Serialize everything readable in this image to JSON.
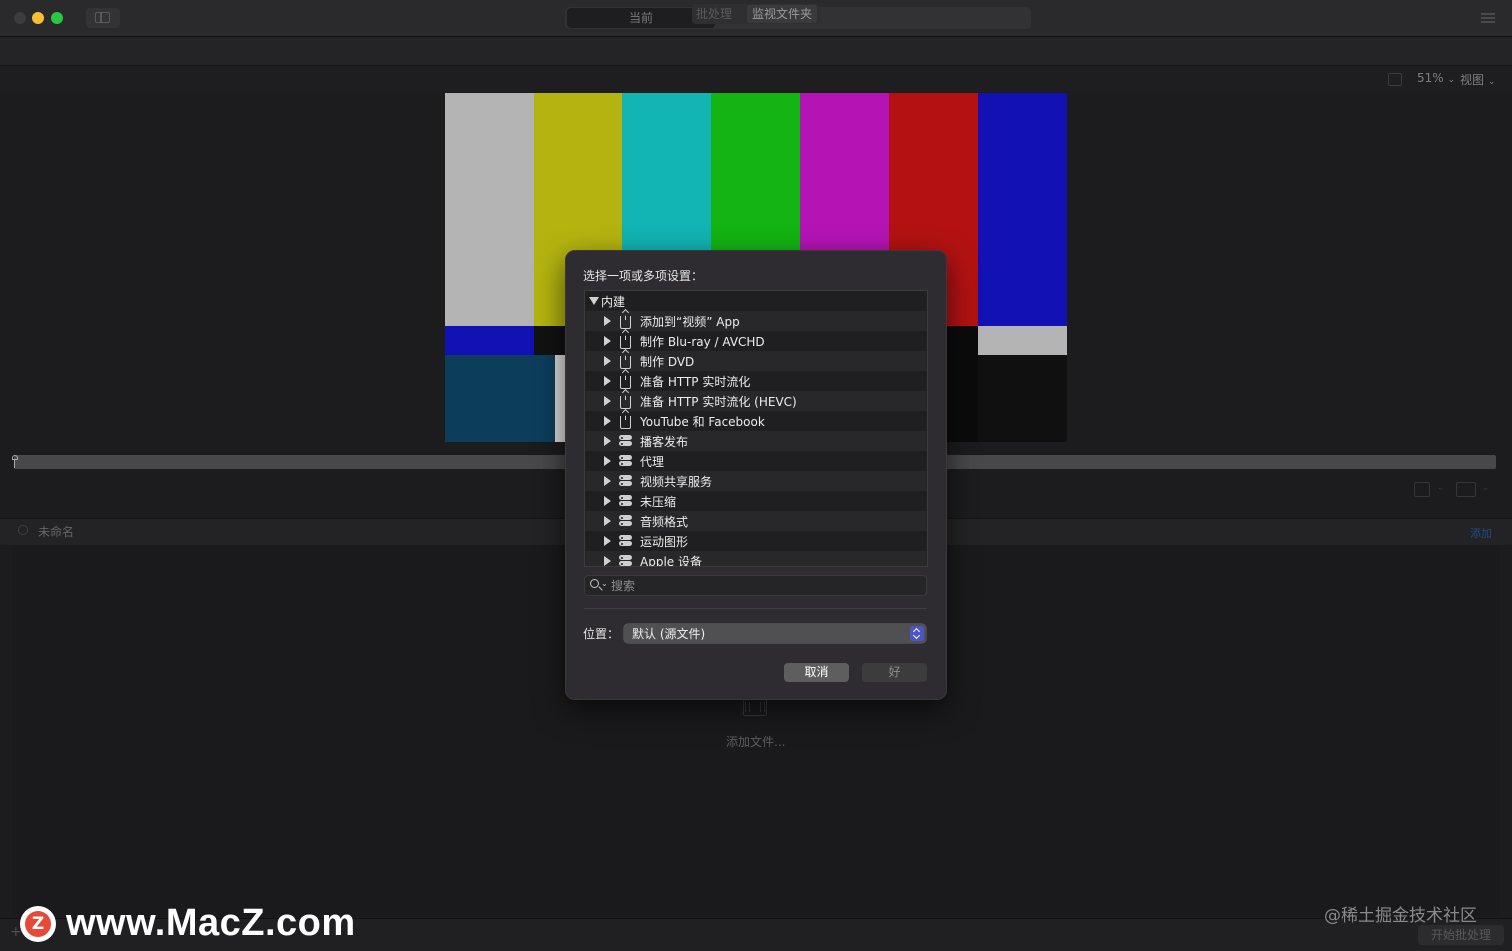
{
  "toolbar": {
    "segments": [
      "当前",
      "",
      ""
    ],
    "sub_segments": [
      "批处理",
      "监视文件夹"
    ]
  },
  "viewer": {
    "zoom": "51%",
    "zoom_chevron": "⌄",
    "view_label": "视图",
    "color_bars": [
      "#b4b4b4",
      "#b4b410",
      "#12b4b4",
      "#14b414",
      "#b414b4",
      "#b41212",
      "#1212b4"
    ]
  },
  "batch": {
    "title": "未命名",
    "add_label": "添加",
    "add_file_label": "添加文件...",
    "start_label": "开始批处理",
    "plus_label": "+"
  },
  "dialog": {
    "prompt": "选择一项或多项设置：",
    "tree_root": "内建",
    "items": [
      {
        "label": "添加到“视频” App",
        "icon": "share-icon"
      },
      {
        "label": "制作 Blu-ray / AVCHD",
        "icon": "share-icon"
      },
      {
        "label": "制作 DVD",
        "icon": "share-icon"
      },
      {
        "label": "准备 HTTP 实时流化",
        "icon": "share-icon"
      },
      {
        "label": "准备 HTTP 实时流化 (HEVC)",
        "icon": "share-icon"
      },
      {
        "label": "YouTube 和 Facebook",
        "icon": "share-icon"
      },
      {
        "label": "播客发布",
        "icon": "group-icon"
      },
      {
        "label": "代理",
        "icon": "group-icon"
      },
      {
        "label": "视频共享服务",
        "icon": "group-icon"
      },
      {
        "label": "未压缩",
        "icon": "group-icon"
      },
      {
        "label": "音频格式",
        "icon": "group-icon"
      },
      {
        "label": "运动图形",
        "icon": "group-icon"
      },
      {
        "label": "Apple 设备",
        "icon": "group-icon"
      }
    ],
    "search_placeholder": "搜索",
    "location_label": "位置：",
    "location_value": "默认 (源文件)",
    "cancel_label": "取消",
    "ok_label": "好"
  },
  "watermark": {
    "logo_letter": "Z",
    "site": "www.MacZ.com",
    "right_text": "@稀土掘金技术社区"
  }
}
